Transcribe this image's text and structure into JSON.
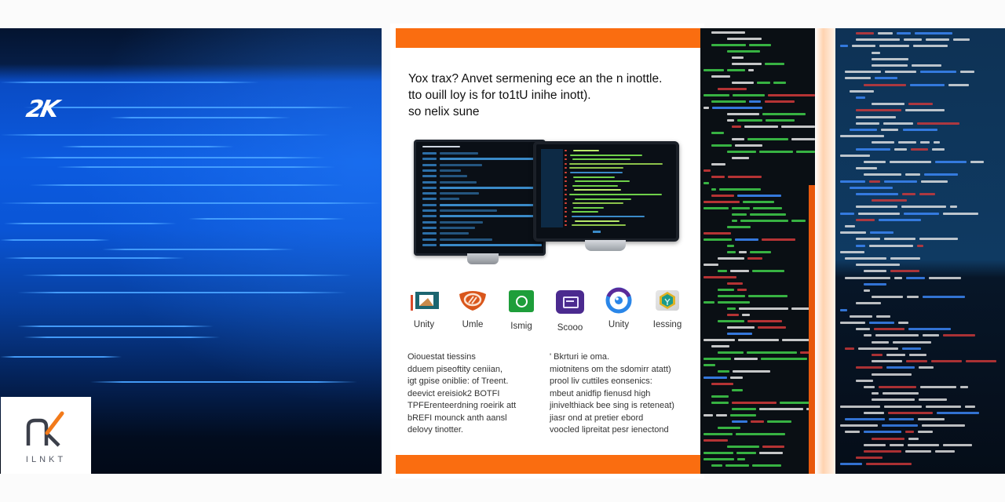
{
  "left_panel": {
    "brand_logo": "2K",
    "partner_logo": {
      "mark": "nk",
      "wordmark": "ILNKT"
    },
    "colors": {
      "background": "#0a55d6",
      "streak": "#46a0ff"
    }
  },
  "document": {
    "accent_color": "#fa6d10",
    "headline": [
      "Yox trax? Anvet sermening ece an the n inottle.",
      "tto ouill loy is for to1tU inihe inott).",
      "so nelix sune"
    ],
    "tools": [
      {
        "label": "Unity",
        "icon": "unity-flag-icon",
        "color": "#1f6e78"
      },
      {
        "label": "Umle",
        "icon": "orange-shield-icon",
        "color": "#d9561b"
      },
      {
        "label": "Ismig",
        "icon": "green-circle-icon",
        "color": "#1e9e3a"
      },
      {
        "label": "Scooo",
        "icon": "purple-terminal-icon",
        "color": "#4b2a8f"
      },
      {
        "label": "Unity",
        "icon": "blue-eye-icon",
        "color": "#2a7fe0"
      },
      {
        "label": "Iessing",
        "icon": "teal-badge-icon",
        "color": "#1a9a8a"
      }
    ],
    "column_left": [
      "Oiouestat tiessins",
      "dduem piseoftity ceniian,",
      "igt gpise oniblie: of Treent.",
      "deevict ereisiok2 BOTFI",
      "TPFErenteerdning roeirik att",
      "bREFI mounck anth aansl",
      "delovy tinotter."
    ],
    "column_right": [
      "' Bkrturi ie oma.",
      "miotnitens om the sdomirr atatt)",
      "prool liv cuttiles eonsenics:",
      "mbeut anidfip fienusd high",
      "jinivelthiack bee sing is reteneat)",
      "jiasr ond at pretier ebord",
      "voocled lipreitat pesr ienectond"
    ]
  },
  "code_panels": {
    "panel_1": {
      "background": "#0a0f14",
      "syntax_colors": [
        "#3fcf4a",
        "#d33a3a",
        "#e8e8e8",
        "#3d8bff"
      ]
    },
    "panel_2": {
      "background": "#0f3a62",
      "syntax_colors": [
        "#e8e8e8",
        "#d33a3a",
        "#3d8bff",
        "#f2f2f2"
      ]
    }
  }
}
